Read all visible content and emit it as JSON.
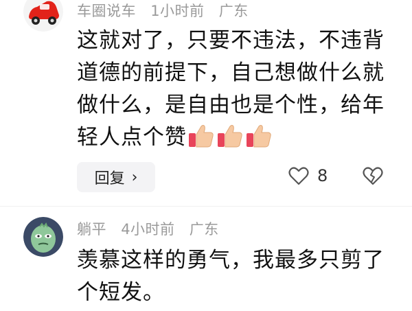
{
  "comments": [
    {
      "user": "车圈说车",
      "time": "1小时前",
      "location": "广东",
      "text": "这就对了，只要不违法，不违背道德的前提下，自己想做什么就做什么，是自由也是个性，给年轻人点个赞",
      "reply_label": "回复",
      "like_count": "8",
      "avatar_icon": "car-avatar-icon"
    },
    {
      "user": "躺平",
      "time": "4小时前",
      "location": "广东",
      "text": "羡慕这样的勇气，我最多只剪了个短发。",
      "avatar_icon": "green-character-avatar-icon"
    }
  ],
  "colors": {
    "meta": "#9a9a9a",
    "text": "#111111",
    "reply_bg": "#f3f3f5"
  }
}
